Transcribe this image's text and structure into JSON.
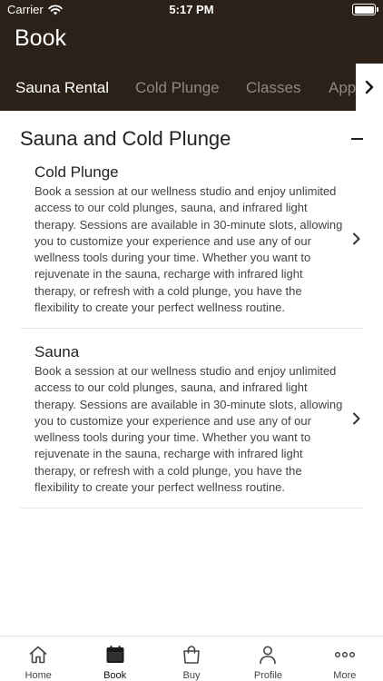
{
  "status_bar": {
    "carrier": "Carrier",
    "time": "5:17 PM"
  },
  "header": {
    "title": "Book"
  },
  "tabs": [
    {
      "label": "Sauna Rental",
      "active": true
    },
    {
      "label": "Cold Plunge",
      "active": false
    },
    {
      "label": "Classes",
      "active": false
    },
    {
      "label": "Appointments",
      "active": false
    }
  ],
  "section": {
    "title": "Sauna and Cold Plunge",
    "items": [
      {
        "title": "Cold Plunge",
        "description": "Book a session at our wellness studio and enjoy unlimited access to our cold plunges, sauna, and infrared light therapy. Sessions are available in 30-minute slots, allowing you to customize your experience and use any of our wellness tools during your time. Whether you want to rejuvenate in the sauna, recharge with infrared light therapy, or refresh with a cold plunge, you have the flexibility to create your perfect wellness routine."
      },
      {
        "title": "Sauna",
        "description": "Book a session at our wellness studio and enjoy unlimited access to our cold plunges, sauna, and infrared light therapy. Sessions are available in 30-minute slots, allowing you to customize your experience and use any of our wellness tools during your time. Whether you want to rejuvenate in the sauna, recharge with infrared light therapy, or refresh with a cold plunge, you have the flexibility to create your perfect wellness routine."
      }
    ]
  },
  "tabbar": [
    {
      "label": "Home",
      "icon": "home-icon"
    },
    {
      "label": "Book",
      "icon": "calendar-icon"
    },
    {
      "label": "Buy",
      "icon": "shopping-bag-icon"
    },
    {
      "label": "Profile",
      "icon": "person-icon"
    },
    {
      "label": "More",
      "icon": "more-icon"
    }
  ],
  "colors": {
    "header_bg": "#2b2118",
    "active_tab": "#ffffff",
    "inactive_tab": "#8f8880"
  }
}
